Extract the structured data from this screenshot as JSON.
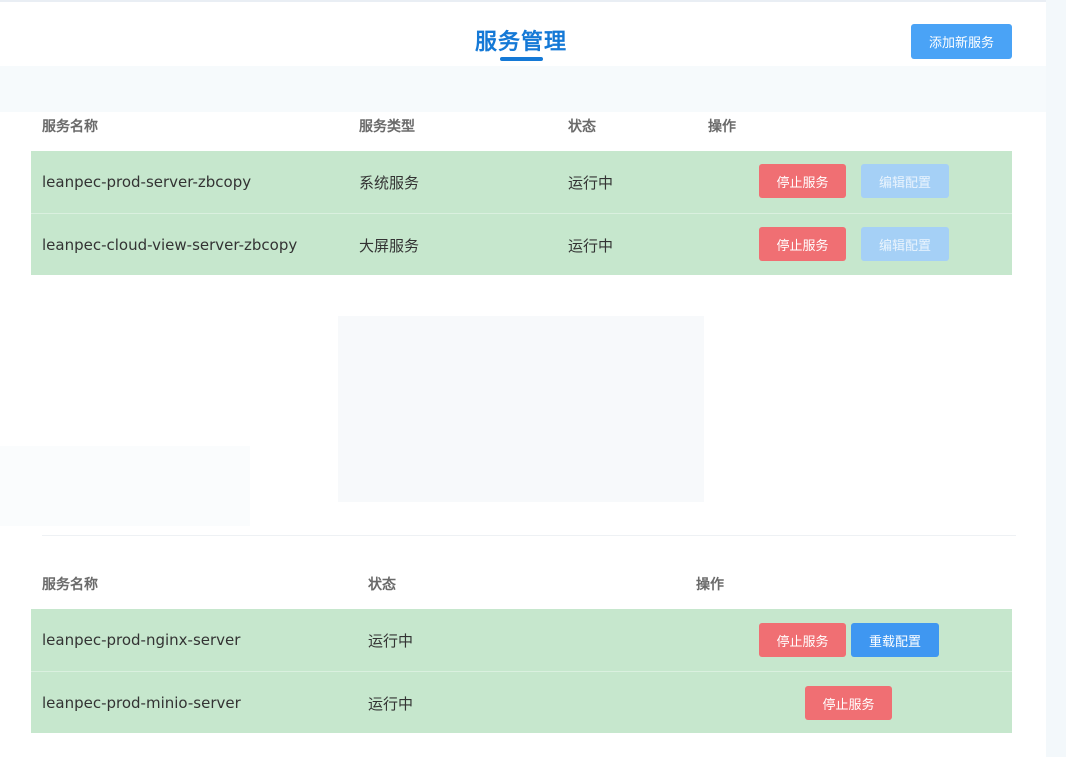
{
  "header": {
    "title": "服务管理",
    "add_button": "添加新服务"
  },
  "table1": {
    "columns": [
      "服务名称",
      "服务类型",
      "状态",
      "操作"
    ],
    "rows": [
      {
        "name": "leanpec-prod-server-zbcopy",
        "type": "系统服务",
        "status": "运行中",
        "actions": [
          "停止服务",
          "编辑配置"
        ]
      },
      {
        "name": "leanpec-cloud-view-server-zbcopy",
        "type": "大屏服务",
        "status": "运行中",
        "actions": [
          "停止服务",
          "编辑配置"
        ]
      }
    ]
  },
  "table2": {
    "columns": [
      "服务名称",
      "状态",
      "操作"
    ],
    "rows": [
      {
        "name": "leanpec-prod-nginx-server",
        "status": "运行中",
        "actions": [
          "停止服务",
          "重载配置"
        ]
      },
      {
        "name": "leanpec-prod-minio-server",
        "status": "运行中",
        "actions": [
          "停止服务"
        ]
      }
    ]
  },
  "colors": {
    "accent": "#1579d6",
    "row_bg": "#c6e7cd",
    "stop": "#f06f73",
    "edit": "#a5d0f6",
    "reload": "#3f97f1"
  }
}
